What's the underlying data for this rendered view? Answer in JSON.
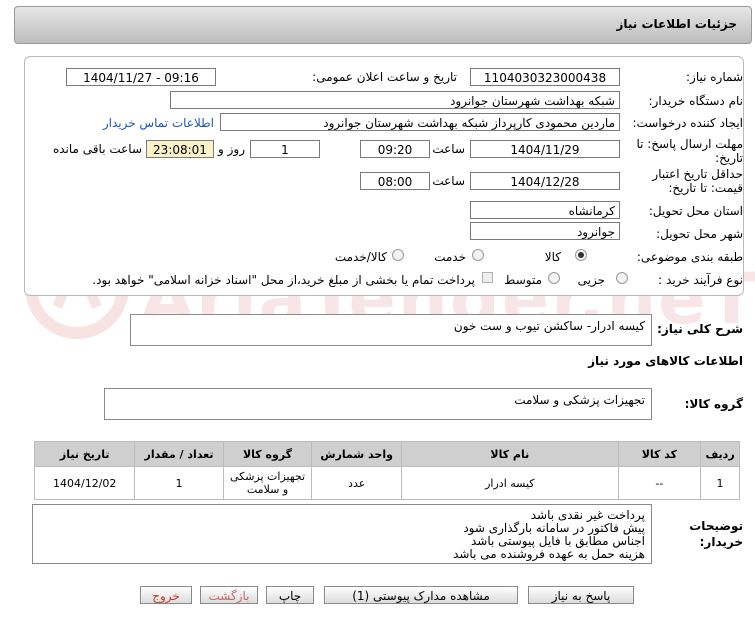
{
  "header": {
    "title": "جزئیات اطلاعات نیاز"
  },
  "form": {
    "need_number_label": "شماره نیاز:",
    "need_number": "1104030323000438",
    "announce_label": "تاریخ و ساعت اعلان عمومی:",
    "announce_value": "1404/11/27 - 09:16",
    "buyer_org_label": "نام دستگاه خریدار:",
    "buyer_org": "شبکه بهداشت شهرستان جوانرود",
    "requester_label": "ایجاد کننده درخواست:",
    "requester": "ماردین محمودی کارپرداز شبکه بهداشت شهرستان جوانرود",
    "contact_link": "اطلاعات تماس خریدار",
    "reply_deadline_label": "مهلت ارسال پاسخ: تا تاریخ:",
    "reply_date": "1404/11/29",
    "time_label": "ساعت",
    "reply_time": "09:20",
    "days_value": "1",
    "days_label": "روز و",
    "remaining_time": "23:08:01",
    "remaining_label": "ساعت باقی مانده",
    "price_validity_label": "حداقل تاریخ اعتبار قیمت: تا تاریخ:",
    "validity_date": "1404/12/28",
    "validity_time": "08:00",
    "province_label": "استان محل تحویل:",
    "province": "کرمانشاه",
    "city_label": "شهر محل تحویل:",
    "city": "جوانرود",
    "category_label": "طبقه بندی موضوعی:",
    "category_options": [
      "کالا",
      "خدمت",
      "کالا/خدمت"
    ],
    "category_selected": "کالا",
    "process_label": "نوع فرآیند خرید :",
    "process_options": [
      "جزیی",
      "متوسط"
    ],
    "payment_note": "پرداخت تمام یا بخشی از مبلغ خرید،از محل \"اسناد خزانه اسلامی\" خواهد بود."
  },
  "summary": {
    "label": "شرح کلی نیاز:",
    "value": "کیسه ادرار- ساکشن تیوب و ست خون"
  },
  "goods": {
    "section_title": "اطلاعات کالاهای مورد نیاز",
    "group_label": "گروه کالا:",
    "group_value": "تجهیزات پزشکی و سلامت",
    "table": {
      "headers": [
        "ردیف",
        "کد کالا",
        "نام کالا",
        "واحد شمارش",
        "گروه کالا",
        "تعداد / مقدار",
        "تاریخ نیاز"
      ],
      "rows": [
        [
          "1",
          "--",
          "کیسه ادرار",
          "عدد",
          "تجهیزات پزشکی و سلامت",
          "1",
          "1404/12/02"
        ]
      ]
    }
  },
  "notes": {
    "label": "توضیحات خریدار:",
    "lines": [
      "پرداخت غیر نقدی باشد",
      "پیش فاکتور در سامانه بارگذاری شود",
      "اجناس مطابق با فایل پیوستی باشد",
      "هزینه حمل به عهده فروشنده می باشد"
    ]
  },
  "buttons": {
    "reply": "پاسخ به نیاز",
    "attachments": "مشاهده مدارک پیوستی (1)",
    "print": "چاپ",
    "back": "بازگشت",
    "exit": "خروج"
  },
  "watermark": {
    "text": "AriaTender.neT"
  },
  "colors": {
    "link": "#1a55c6",
    "remaining_bg": "#fbf1c6",
    "back_text": "#c46a6a",
    "exit_text": "#c0392b"
  }
}
